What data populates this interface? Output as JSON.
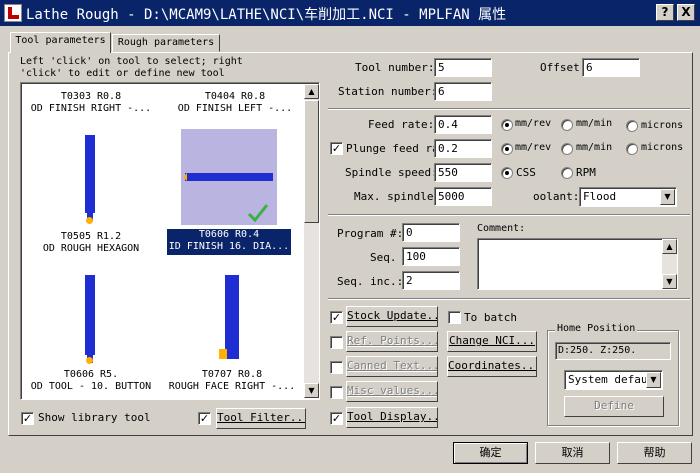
{
  "window": {
    "title": "Lathe Rough - D:\\MCAM9\\LATHE\\NCI\\车削加工.NCI - MPLFAN 属性",
    "help_button": "?",
    "close_button": "X"
  },
  "tabs": [
    {
      "label": "Tool parameters",
      "active": true
    },
    {
      "label": "Rough parameters",
      "active": false
    }
  ],
  "instructions": {
    "line1": "Left 'click' on tool to select; right",
    "line2": "'click' to edit or define new tool"
  },
  "tools": [
    {
      "line1": "T0303 R0.8",
      "line2": "OD FINISH RIGHT -..."
    },
    {
      "line1": "T0404 R0.8",
      "line2": "OD FINISH LEFT -..."
    },
    {
      "line1": "T0505 R1.2",
      "line2": "OD ROUGH HEXAGON"
    },
    {
      "line1": "T0606 R0.4",
      "line2": "ID FINISH 16. DIA...",
      "selected": true
    },
    {
      "line1": "T0606 R5.",
      "line2": "OD TOOL - 10. BUTTON"
    },
    {
      "line1": "T0707 R0.8",
      "line2": "ROUGH FACE RIGHT -..."
    }
  ],
  "bottom_left": {
    "show_library_label": "Show library tool",
    "tool_filter_label": "Tool Filter...",
    "tool_display_label": "Tool Display..."
  },
  "fields": {
    "tool_number_label": "Tool number:",
    "tool_number": "5",
    "offset_label": "Offset",
    "offset": "6",
    "station_number_label": "Station number:",
    "station_number": "6",
    "feed_rate_label": "Feed rate:",
    "feed_rate": "0.4",
    "plunge_feed_label": "Plunge feed ra",
    "plunge_feed": "0.2",
    "spindle_speed_label": "Spindle speed:",
    "spindle_speed": "550",
    "max_spindle_label": "Max. spindle",
    "max_spindle": "5000",
    "coolant_label": "oolant:",
    "coolant": "Flood",
    "program_label": "Program #:",
    "program": "0",
    "seq_label": "Seq.",
    "seq": "100",
    "seq_inc_label": "Seq. inc.:",
    "seq_inc": "2",
    "comment_label": "Comment:"
  },
  "units": {
    "mm_rev": "mm/rev",
    "mm_min": "mm/min",
    "microns": "microns",
    "css": "CSS",
    "rpm": "RPM"
  },
  "buttons": {
    "stock_update": "Stock Update...",
    "ref_points": "Ref. Points...",
    "canned_text": "Canned Text...",
    "misc_values": "Misc values...",
    "to_batch": "To batch",
    "change_nci": "Change NCI...",
    "coordinates": "Coordinates..."
  },
  "home_position": {
    "group_label": "Home Position",
    "value": "D:250.  Z:250.",
    "select": "System defaul",
    "define_label": "Define"
  },
  "footer": {
    "ok": "确定",
    "cancel": "取消",
    "help": "帮助"
  },
  "colors": {
    "titlebar": "#0a246a",
    "selection": "#0a246a",
    "tool_blue": "#1f2ed3",
    "tool_tip": "#ffb000",
    "selected_bg": "#b9b4e0",
    "checkmark": "#3cb043"
  }
}
